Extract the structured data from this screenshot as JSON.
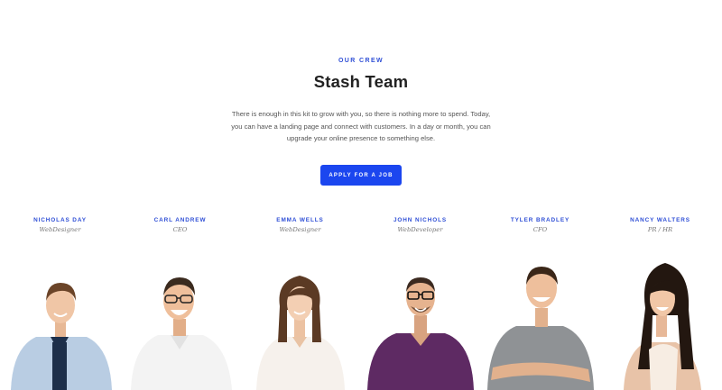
{
  "section": {
    "eyebrow": "OUR CREW",
    "title": "Stash Team",
    "description": "There is enough in this kit to grow with you, so there is nothing more to spend. Today, you can have a landing page and connect with customers. In a day or month, you can upgrade your online presence to something else.",
    "cta_label": "APPLY FOR A JOB"
  },
  "colors": {
    "accent": "#1b46ef",
    "eyebrow": "#2f4fd6"
  },
  "team": [
    {
      "name": "NICHOLAS DAY",
      "role": "WebDesigner"
    },
    {
      "name": "CARL ANDREW",
      "role": "CEO"
    },
    {
      "name": "EMMA WELLS",
      "role": "WebDesigner"
    },
    {
      "name": "JOHN NICHOLS",
      "role": "WebDeveloper"
    },
    {
      "name": "TYLER BRADLEY",
      "role": "CFO"
    },
    {
      "name": "NANCY WALTERS",
      "role": "PR / HR"
    }
  ]
}
